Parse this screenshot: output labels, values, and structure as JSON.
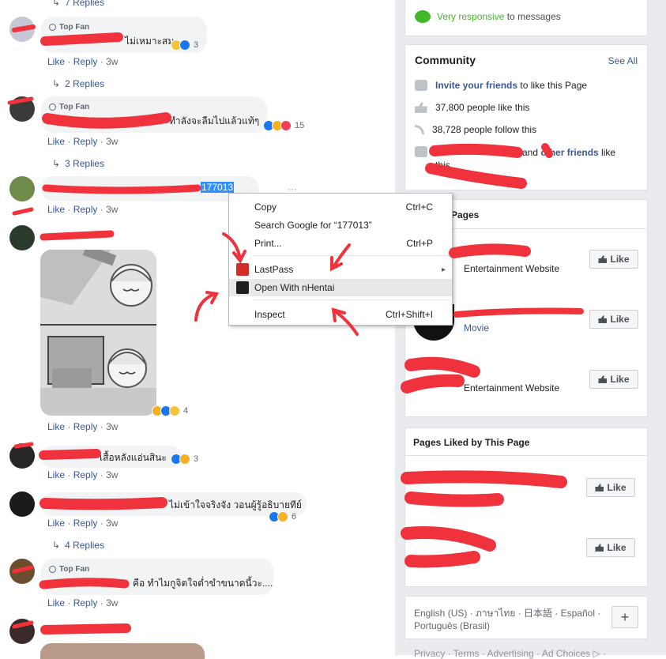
{
  "comments": [
    {
      "top_fan": "",
      "text": "",
      "time": "",
      "reacts": "",
      "replies": "7 Replies"
    },
    {
      "top_fan": "Top Fan",
      "text": "ไม่เหมาะสม",
      "time": "3w",
      "reacts": "3",
      "replies": "2 Replies"
    },
    {
      "top_fan": "Top Fan",
      "text": "ทำลังจะลืมไปแล้วแท้ๆ",
      "time": "3w",
      "reacts": "15",
      "replies": "3 Replies"
    },
    {
      "top_fan": "",
      "text": "177013",
      "time": "3w",
      "reacts": "",
      "replies": ""
    },
    {
      "top_fan": "",
      "text": "",
      "time": "3w",
      "reacts": "4",
      "replies": ""
    },
    {
      "top_fan": "",
      "text": "เสื้อหลังแอ่นสินะ",
      "time": "3w",
      "reacts": "3",
      "replies": ""
    },
    {
      "top_fan": "",
      "text": "ไม่เข้าใจจริงจัง วอนผู้รู้อธิบายทีย์",
      "time": "3w",
      "reacts": "6",
      "replies": "4 Replies"
    },
    {
      "top_fan": "Top Fan",
      "text": "คือ ทำไมกูจิตใจต่ำขำขนาดนี้วะ....",
      "time": "3w",
      "reacts": "",
      "replies": ""
    }
  ],
  "actions": {
    "like": "Like",
    "reply": "Reply",
    "dot": "·"
  },
  "context_menu": {
    "items": [
      {
        "label": "Copy",
        "shortcut": "Ctrl+C"
      },
      {
        "label": "Search Google for “177013”",
        "shortcut": ""
      },
      {
        "label": "Print...",
        "shortcut": "Ctrl+P"
      },
      {
        "label": "LastPass",
        "shortcut": "▸"
      },
      {
        "label": "Open With nHentai",
        "shortcut": ""
      },
      {
        "label": "Inspect",
        "shortcut": "Ctrl+Shift+I"
      }
    ]
  },
  "sidebar": {
    "responsive": {
      "strong": "Very responsive",
      "rest": " to messages"
    },
    "community": {
      "title": "Community",
      "see_all": "See All",
      "invite_link": "Invite your friends",
      "invite_rest": " to like this Page",
      "likes": "37,800 people like this",
      "follows": "38,728 people follow this",
      "friends_and": "and",
      "friends_link": "other friends",
      "friends_rest": " like",
      "friends_this": "this"
    },
    "related": {
      "title": "Pages",
      "items": [
        {
          "sub": "Entertainment Website",
          "button": "Like"
        },
        {
          "sub": "Movie",
          "button": "Like"
        },
        {
          "sub": "Entertainment Website",
          "button": "Like"
        }
      ]
    },
    "liked": {
      "title": "Pages Liked by This Page",
      "buttons": [
        "Like",
        "Like"
      ]
    },
    "languages": {
      "line1": "English (US) · ภาษาไทย · 日本語 · Español ·",
      "line2": "Português (Brasil)",
      "plus": "+"
    },
    "footer": "Privacy · Terms · Advertising · Ad Choices ▷ ·"
  },
  "colors": {
    "link": "#385898",
    "scribble": "#f0323c",
    "selection": "#3390ff"
  }
}
